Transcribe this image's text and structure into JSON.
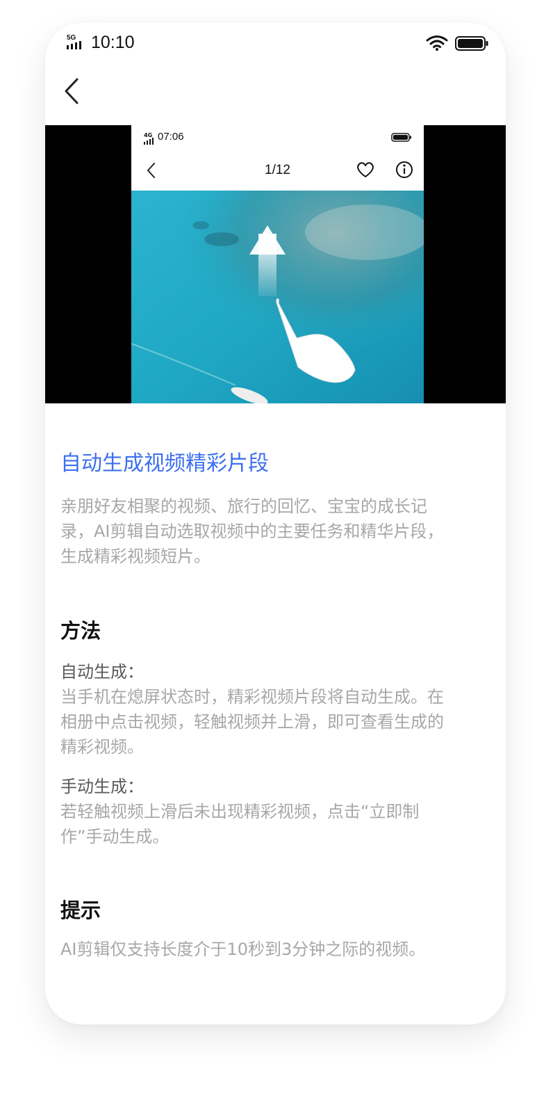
{
  "status_bar": {
    "network": "5G",
    "time": "10:10"
  },
  "preview": {
    "status": {
      "network": "4G",
      "time": "07:06"
    },
    "counter": "1/12"
  },
  "article": {
    "title": "自动生成视频精彩片段",
    "intro": [
      "亲朋好友相聚的视频、旅行的回忆、宝宝的成长记",
      "录，AI剪辑自动选取视频中的主要任务和精华片段，",
      "生成精彩视频短片。"
    ],
    "method_heading": "方法",
    "auto_label": "自动生成：",
    "auto_text": [
      "当手机在熄屏状态时，精彩视频片段将自动生成。在",
      "相册中点击视频，轻触视频并上滑，即可查看生成的",
      "精彩视频。"
    ],
    "manual_label": "手动生成：",
    "manual_text": [
      "若轻触视频上滑后未出现精彩视频，点击“立即制",
      "作”手动生成。"
    ],
    "tip_heading": "提示",
    "tip_text": "AI剪辑仅支持长度介于10秒到3分钟之际的视频。"
  },
  "colors": {
    "accent": "#3c6ff0",
    "body_text": "#a7a7a7",
    "label_text": "#5a5a5a",
    "sea": "#1fa8c4"
  }
}
